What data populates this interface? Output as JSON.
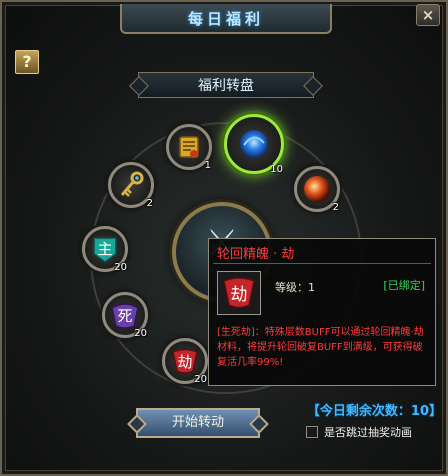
{
  "window": {
    "title": "每日福利",
    "close_label": "×"
  },
  "help_label": "?",
  "wheel": {
    "title": "福利转盘",
    "hub_glyph": "⚔",
    "slots": [
      {
        "name": "scroll",
        "count": "1"
      },
      {
        "name": "blue-orb",
        "count": "10",
        "selected": true
      },
      {
        "name": "fire-orb",
        "count": "2"
      },
      {
        "name": "key",
        "count": "2"
      },
      {
        "name": "glyph-zhu",
        "label": "主",
        "count": "20"
      },
      {
        "name": "glyph-si",
        "label": "死",
        "count": "20"
      },
      {
        "name": "glyph-jie",
        "label": "劫",
        "count": "20"
      }
    ]
  },
  "tooltip": {
    "title": "轮回精魄 · 劫",
    "icon_label": "劫",
    "level": "等级：1",
    "bound": "[已绑定]",
    "description": "[生死劫]：特殊层数BUFF可以通过轮回精魄·劫材料，将提升轮回破复BUFF到满级，可获得破复活几率99%!"
  },
  "controls": {
    "start_label": "开始转动",
    "remaining": "【今日剩余次数：10】",
    "skip_label": "是否跳过抽奖动画"
  },
  "colors": {
    "selected_ring": "#9eea3a",
    "tooltip_title": "#ff3c3c",
    "bound": "#34d65a",
    "remaining": "#41b8ff"
  }
}
